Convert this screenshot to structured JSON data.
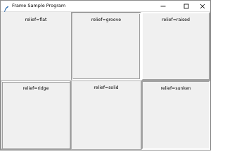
{
  "window": {
    "title": "Frame Sample Program",
    "controls": {
      "minimize": "minimize-icon",
      "maximize": "maximize-icon",
      "close": "close-icon"
    }
  },
  "frames": [
    {
      "label": "relief=flat"
    },
    {
      "label": "relief=groove"
    },
    {
      "label": "relief=raised"
    },
    {
      "label": "relief=ridge"
    },
    {
      "label": "relief=solid"
    },
    {
      "label": "relief=sunken"
    }
  ],
  "colors": {
    "background": "#f0f0f0",
    "titlebar": "#ffffff",
    "icon_accent": "#2b6cb0"
  }
}
